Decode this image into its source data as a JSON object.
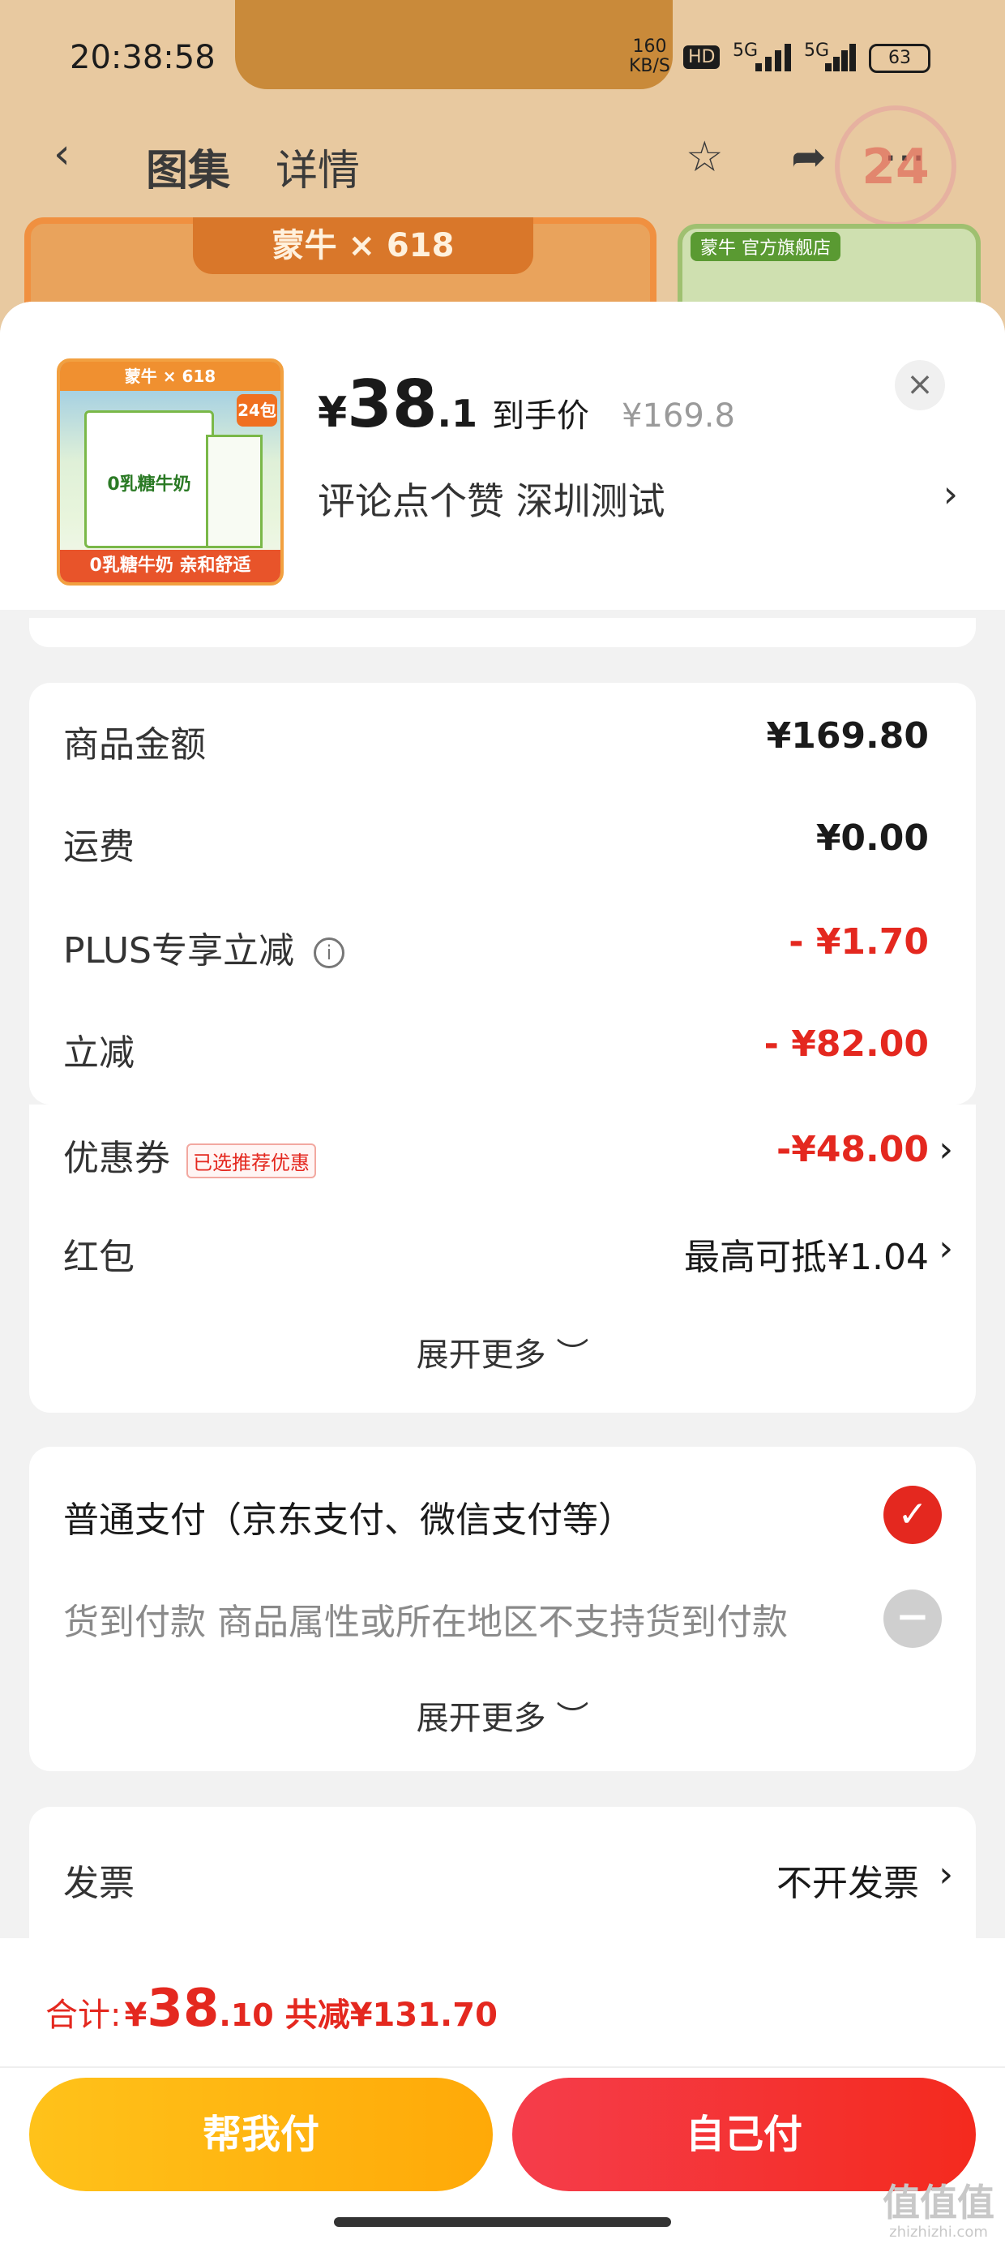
{
  "status_bar": {
    "time": "20:38:58",
    "net_speed": "160",
    "net_unit": "KB/S",
    "hd": "HD",
    "sig1": "5G",
    "sig2": "5G",
    "battery": "63"
  },
  "background": {
    "nav_tab_gallery": "图集",
    "nav_tab_details": "详情",
    "banner_text": "蒙牛 × 618",
    "store_tag": "蒙牛 官方旗舰店",
    "sticker": "24包"
  },
  "product": {
    "thumb_top": "蒙牛 × 618",
    "thumb_label": "0乳糖牛奶",
    "thumb_badge": "24包",
    "thumb_bottom": "0乳糖牛奶 亲和舒适",
    "price_currency": "¥",
    "price_int": "38",
    "price_dec": ".1",
    "price_label": "到手价",
    "original_price": "¥169.8",
    "spec_text": "评论点个赞  深圳测试",
    "close": "×",
    "chevron": "›"
  },
  "summary": {
    "rows": [
      {
        "label": "商品金额",
        "value": "¥169.80"
      },
      {
        "label": "运费",
        "value": "¥0.00"
      },
      {
        "label": "PLUS专享立减",
        "value": "- ¥1.70"
      },
      {
        "label": "立减",
        "value": "- ¥82.00"
      },
      {
        "label": "优惠券",
        "tag": "已选推荐优惠",
        "value": "-¥48.00"
      },
      {
        "label": "红包",
        "value": "最高可抵¥1.04"
      }
    ],
    "info_icon": "i",
    "expand": "展开更多 ︶"
  },
  "payment": {
    "option1": "普通支付（京东支付、微信支付等）",
    "option2": "货到付款 商品属性或所在地区不支持货到付款",
    "expand": "展开更多 ︶",
    "check": "✓",
    "disabled": "−"
  },
  "invoice": {
    "label": "发票",
    "value": "不开发票"
  },
  "footer": {
    "total_label": "合计:",
    "total_currency": "¥",
    "total_int": "38",
    "total_dec": ".10",
    "total_reduced": "共减¥131.70",
    "help_pay": "帮我付",
    "self_pay": "自己付"
  },
  "watermark": {
    "text": "值值值",
    "site": "zhizhizhi.com"
  },
  "colors": {
    "accent_red": "#e4281f",
    "help_button": "#ffb40f",
    "self_button": "#f5333a"
  }
}
